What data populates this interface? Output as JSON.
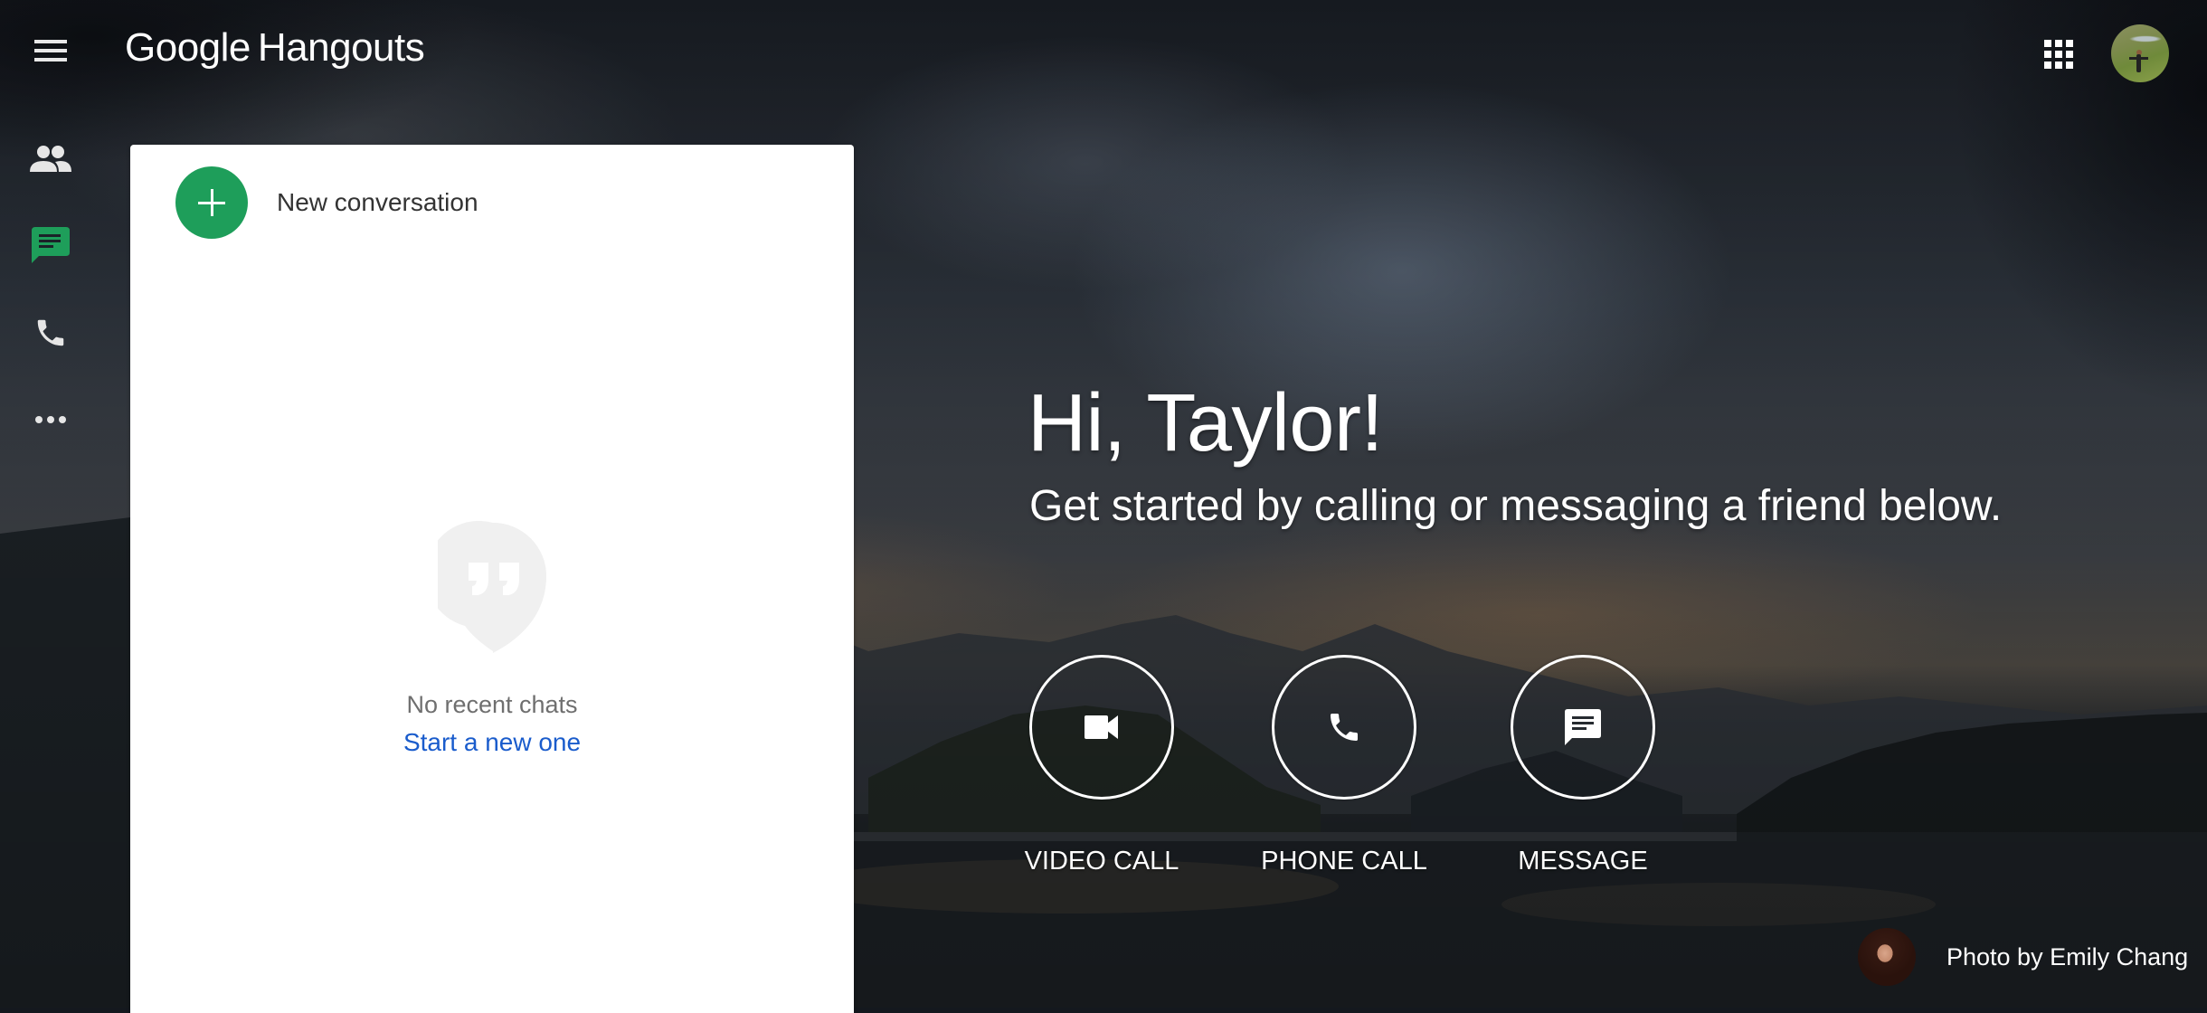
{
  "app": {
    "brand_google": "Google",
    "brand_product": "Hangouts"
  },
  "header": {
    "menu_icon": "hamburger-menu-icon",
    "apps_icon": "apps-grid-icon",
    "account_avatar": "profile-photo"
  },
  "nav": {
    "items": [
      {
        "id": "contacts",
        "icon": "people-icon",
        "active": false
      },
      {
        "id": "conversations",
        "icon": "chat-icon",
        "active": true
      },
      {
        "id": "phone-calls",
        "icon": "phone-icon",
        "active": false
      },
      {
        "id": "more",
        "icon": "more-horizontal-icon",
        "active": false
      }
    ]
  },
  "panel": {
    "new_conversation_label": "New conversation",
    "empty_title": "No recent chats",
    "empty_link": "Start a new one"
  },
  "main": {
    "greeting": "Hi, Taylor!",
    "subtitle": "Get started by calling or messaging a friend below.",
    "actions": [
      {
        "label": "VIDEO CALL",
        "icon": "videocam-icon"
      },
      {
        "label": "PHONE CALL",
        "icon": "phone-icon"
      },
      {
        "label": "MESSAGE",
        "icon": "message-icon"
      }
    ]
  },
  "credit": {
    "text": "Photo by Emily Chang"
  },
  "colors": {
    "accent_green": "#1e9e5a",
    "link_blue": "#1a5ccc",
    "panel_bg": "#ffffff"
  }
}
